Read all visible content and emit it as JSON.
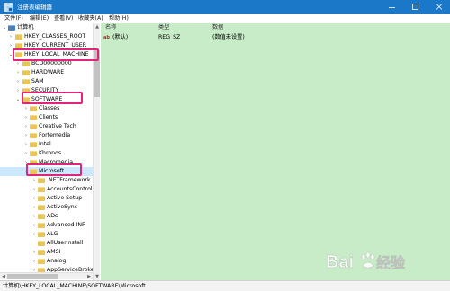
{
  "window": {
    "title": "注册表编辑器",
    "controls": {
      "minimize": "minimize-icon",
      "maximize": "maximize-icon",
      "close": "close-icon"
    }
  },
  "menu": {
    "items": [
      {
        "label": "文件(F)"
      },
      {
        "label": "编辑(E)"
      },
      {
        "label": "查看(V)"
      },
      {
        "label": "收藏夹(A)"
      },
      {
        "label": "帮助(H)"
      }
    ]
  },
  "tree": {
    "items": [
      {
        "label": "计算机",
        "expanded": true,
        "icon": "computer-icon"
      },
      {
        "label": "HKEY_CLASSES_ROOT",
        "expanded": false,
        "icon": "folder-icon"
      },
      {
        "label": "HKEY_CURRENT_USER",
        "expanded": false,
        "icon": "folder-icon"
      },
      {
        "label": "HKEY_LOCAL_MACHINE",
        "expanded": true,
        "icon": "folder-icon",
        "highlighted": true
      },
      {
        "label": "BCD00000000",
        "expanded": false,
        "icon": "folder-icon"
      },
      {
        "label": "HARDWARE",
        "expanded": false,
        "icon": "folder-icon"
      },
      {
        "label": "SAM",
        "expanded": false,
        "icon": "folder-icon"
      },
      {
        "label": "SECURITY",
        "expanded": false,
        "icon": "folder-icon"
      },
      {
        "label": "SOFTWARE",
        "expanded": true,
        "icon": "folder-icon",
        "highlighted": true
      },
      {
        "label": "Classes",
        "expanded": false,
        "icon": "folder-icon"
      },
      {
        "label": "Clients",
        "expanded": false,
        "icon": "folder-icon"
      },
      {
        "label": "Creative Tech",
        "expanded": false,
        "icon": "folder-icon"
      },
      {
        "label": "Fortemedia",
        "expanded": false,
        "icon": "folder-icon"
      },
      {
        "label": "Intel",
        "expanded": false,
        "icon": "folder-icon"
      },
      {
        "label": "Khronos",
        "expanded": false,
        "icon": "folder-icon"
      },
      {
        "label": "Macromedia",
        "expanded": false,
        "icon": "folder-icon"
      },
      {
        "label": "Microsoft",
        "expanded": true,
        "icon": "folder-icon",
        "highlighted": true,
        "selected": true
      },
      {
        "label": ".NETFramework",
        "expanded": false,
        "icon": "folder-icon"
      },
      {
        "label": "AccountsControl",
        "expanded": false,
        "icon": "folder-icon"
      },
      {
        "label": "Active Setup",
        "expanded": false,
        "icon": "folder-icon"
      },
      {
        "label": "ActiveSync",
        "expanded": false,
        "icon": "folder-icon"
      },
      {
        "label": "ADs",
        "expanded": false,
        "icon": "folder-icon"
      },
      {
        "label": "Advanced INF",
        "expanded": false,
        "icon": "folder-icon"
      },
      {
        "label": "ALG",
        "expanded": false,
        "icon": "folder-icon"
      },
      {
        "label": "AllUserInstall",
        "expanded": false,
        "icon": "folder-icon"
      },
      {
        "label": "AMSI",
        "expanded": false,
        "icon": "folder-icon"
      },
      {
        "label": "Analog",
        "expanded": false,
        "icon": "folder-icon"
      },
      {
        "label": "AppServiceBroker",
        "expanded": false,
        "icon": "folder-icon"
      }
    ]
  },
  "list": {
    "columns": [
      "名称",
      "类型",
      "数据"
    ],
    "rows": [
      {
        "name": "(默认)",
        "type": "REG_SZ",
        "data": "(数值未设置)",
        "icon": "string-value-icon"
      }
    ],
    "background": "#c8ecc8"
  },
  "status": {
    "path": "计算机\\HKEY_LOCAL_MACHINE\\SOFTWARE\\Microsoft"
  },
  "watermark": {
    "text": "Bai du 经验"
  },
  "colors": {
    "titlebar": "#1b78c8",
    "highlight": "#e0267c",
    "list_bg": "#c8ecc8"
  }
}
